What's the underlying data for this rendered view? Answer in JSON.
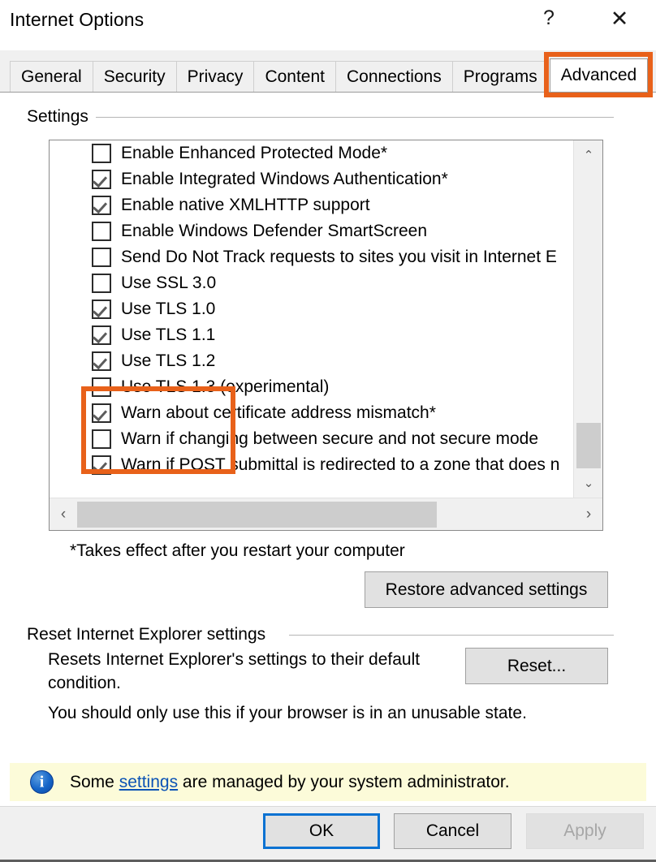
{
  "window": {
    "title": "Internet Options",
    "help_icon": "question-mark-icon",
    "help_label": "?",
    "close_label": "✕"
  },
  "tabs": [
    {
      "label": "General",
      "selected": false
    },
    {
      "label": "Security",
      "selected": false
    },
    {
      "label": "Privacy",
      "selected": false
    },
    {
      "label": "Content",
      "selected": false
    },
    {
      "label": "Connections",
      "selected": false
    },
    {
      "label": "Programs",
      "selected": false
    },
    {
      "label": "Advanced",
      "selected": true
    }
  ],
  "settings_group": {
    "label": "Settings",
    "options": [
      {
        "label": "Enable Enhanced Protected Mode*",
        "checked": false,
        "highlighted": false
      },
      {
        "label": "Enable Integrated Windows Authentication*",
        "checked": true,
        "highlighted": false
      },
      {
        "label": "Enable native XMLHTTP support",
        "checked": true,
        "highlighted": false
      },
      {
        "label": "Enable Windows Defender SmartScreen",
        "checked": false,
        "highlighted": false
      },
      {
        "label": "Send Do Not Track requests to sites you visit in Internet E",
        "checked": false,
        "highlighted": false
      },
      {
        "label": "Use SSL 3.0",
        "checked": false,
        "highlighted": false
      },
      {
        "label": "Use TLS 1.0",
        "checked": true,
        "highlighted": true
      },
      {
        "label": "Use TLS 1.1",
        "checked": true,
        "highlighted": true
      },
      {
        "label": "Use TLS 1.2",
        "checked": true,
        "highlighted": true
      },
      {
        "label": "Use TLS 1.3 (experimental)",
        "checked": false,
        "highlighted": false
      },
      {
        "label": "Warn about certificate address mismatch*",
        "checked": true,
        "highlighted": false
      },
      {
        "label": "Warn if changing between secure and not secure mode",
        "checked": false,
        "highlighted": false
      },
      {
        "label": "Warn if POST submittal is redirected to a zone that does n",
        "checked": true,
        "highlighted": false
      }
    ],
    "scrollbar": {
      "up_arrow": "⌃",
      "down_arrow": "⌄",
      "left_arrow": "‹",
      "right_arrow": "›"
    },
    "footnote": "*Takes effect after you restart your computer",
    "restore_button": "Restore advanced settings"
  },
  "reset_group": {
    "label": "Reset Internet Explorer settings",
    "description": "Resets Internet Explorer's settings to their default condition.",
    "reset_button": "Reset...",
    "warning": "You should only use this if your browser is in an unusable state."
  },
  "info_bar": {
    "icon": "info-icon",
    "text_before": "Some ",
    "link": "settings",
    "text_after": " are managed by your system administrator."
  },
  "command_bar": {
    "ok": "OK",
    "cancel": "Cancel",
    "apply": "Apply",
    "apply_disabled": true
  },
  "colors": {
    "highlight_orange": "#e8611a",
    "focus_blue": "#0a72d2",
    "infobar_yellow": "#fcfbd9",
    "link_blue": "#0b53b5"
  }
}
